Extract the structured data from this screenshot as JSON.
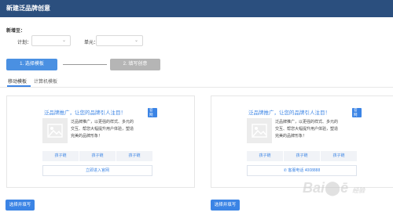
{
  "header": {
    "title": "新建泛品牌创意"
  },
  "form": {
    "section_label": "新增至：",
    "plan_label": "计划：",
    "plan_value": "",
    "unit_label": "单元：",
    "unit_value": ""
  },
  "steps": [
    {
      "label": "1. 选择模板",
      "state": "active",
      "color": "#4a90e2"
    },
    {
      "label": "2. 填写创意",
      "state": "inactive",
      "color": "#b5b5b5"
    }
  ],
  "tabs": [
    {
      "label": "移动模板",
      "active": true
    },
    {
      "label": "计算机模板",
      "active": false
    }
  ],
  "cards": [
    {
      "title": "泛品牌推广，让您的品牌引人注目！",
      "badge": "官网",
      "desc": [
        "泛品牌推广，以更强的样式、多元的",
        "交互、帮您大幅提升用户体验，塑造",
        "完美的品牌形象！"
      ],
      "sublinks": [
        "孩子链",
        "孩子链",
        "孩子链"
      ],
      "wide_button": "立即进入官网",
      "phone_number": "",
      "select_label": "选择并填写"
    },
    {
      "title": "泛品牌推广，让您的品牌引人注目！",
      "badge": "官网",
      "desc": [
        "泛品牌推广，以更强的样式、多元的",
        "交互、帮您大幅提升用户体验，塑造",
        "完美的品牌形象！"
      ],
      "sublinks": [
        "孩子链",
        "孩子链",
        "孩子链"
      ],
      "wide_button": "客服电话",
      "phone_number": "4008888",
      "select_label": "选择并填写"
    }
  ],
  "icons": {
    "image_placeholder": "image-icon",
    "phone": "phone-icon",
    "dropdown": "chevron-down-icon"
  },
  "colors": {
    "header_bg": "#2b4f7e",
    "accent": "#3b84e5"
  }
}
